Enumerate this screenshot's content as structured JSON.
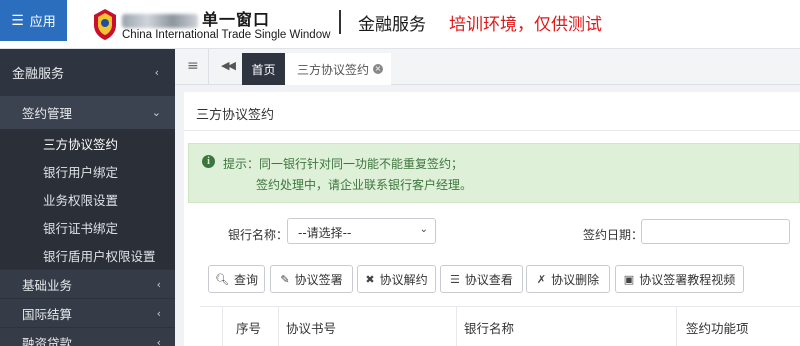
{
  "header": {
    "menu_icon": "hamburger-icon",
    "menu_label": "应用",
    "brand_zh": "单一窗口",
    "brand_en": "China International Trade Single Window",
    "service_title": "金融服务",
    "env_notice": "培训环境，仅供测试",
    "colors": {
      "menu_bg": "#2a6ebd",
      "env_notice": "#e01818"
    }
  },
  "sidebar": {
    "top_label": "金融服务",
    "group_label": "签约管理",
    "sub_items": [
      "三方协议签约",
      "银行用户绑定",
      "业务权限设置",
      "银行证书绑定",
      "银行盾用户权限设置"
    ],
    "items": [
      "基础业务",
      "国际结算",
      "融资贷款"
    ],
    "colors": {
      "bg": "#353b47",
      "sub_bg": "#2a2f38"
    }
  },
  "tabs": {
    "home_label": "首页",
    "current_label": "三方协议签约",
    "close_symbol": "×"
  },
  "panel": {
    "title": "三方协议签约",
    "alert_line1": "提示：同一银行针对同一功能不能重复签约；",
    "alert_line2": "签约处理中，请企业联系银行客户经理。",
    "alert_icon": "info-icon",
    "bank_label": "银行名称：",
    "bank_select_value": "--请选择--",
    "date_label": "签约日期：",
    "buttons": [
      {
        "label": "查询",
        "icon": "search-icon"
      },
      {
        "label": "协议签署",
        "icon": "edit-icon"
      },
      {
        "label": "协议解约",
        "icon": "close-icon"
      },
      {
        "label": "协议查看",
        "icon": "list-icon"
      },
      {
        "label": "协议删除",
        "icon": "user-delete-icon"
      },
      {
        "label": "协议签署教程视频",
        "icon": "film-icon"
      }
    ],
    "table_headers": [
      "序号",
      "协议书号",
      "银行名称",
      "签约功能项"
    ]
  }
}
